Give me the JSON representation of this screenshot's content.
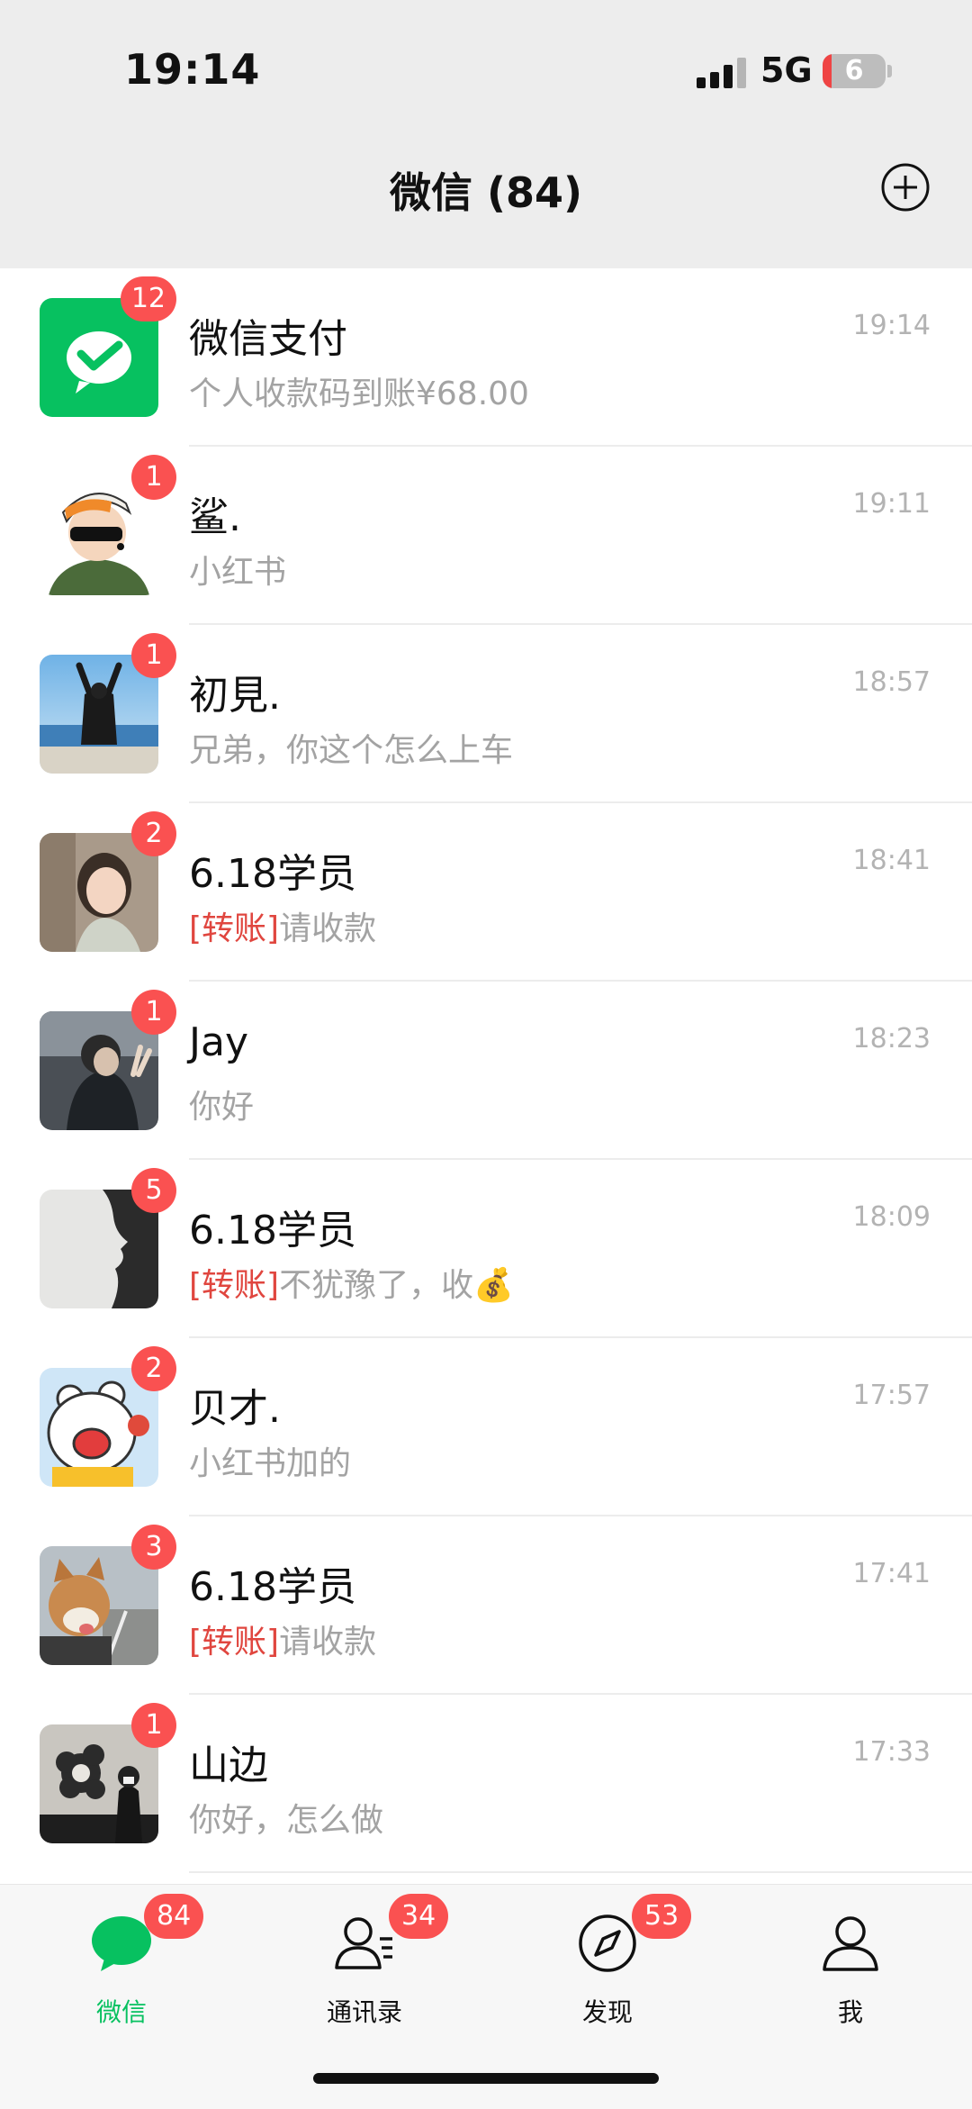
{
  "status": {
    "time": "19:14",
    "network": "5G",
    "battery": "6"
  },
  "header": {
    "title": "微信 (84)"
  },
  "chats": [
    {
      "name": "微信支付",
      "preview": "个人收款码到账¥68.00",
      "time": "19:14",
      "unread": "12",
      "avatar": "wechat-pay-icon"
    },
    {
      "name": "鲨.",
      "preview": "小红书",
      "time": "19:11",
      "unread": "1",
      "avatar": "cartoon-avatar"
    },
    {
      "name": "初見.",
      "preview": "兄弟，你这个怎么上车",
      "time": "18:57",
      "unread": "1",
      "avatar": "beach-photo"
    },
    {
      "name": "6.18学员",
      "tag": "[转账]",
      "preview": "请收款",
      "time": "18:41",
      "unread": "2",
      "avatar": "girl-photo"
    },
    {
      "name": "Jay",
      "preview": "你好",
      "time": "18:23",
      "unread": "1",
      "avatar": "car-photo"
    },
    {
      "name": "6.18学员",
      "tag": "[转账]",
      "preview": "不犹豫了，收💰",
      "time": "18:09",
      "unread": "5",
      "avatar": "silhouette-photo"
    },
    {
      "name": "贝才.",
      "preview": "小红书加的",
      "time": "17:57",
      "unread": "2",
      "avatar": "bear-cartoon"
    },
    {
      "name": "6.18学员",
      "tag": "[转账]",
      "preview": "请收款",
      "time": "17:41",
      "unread": "3",
      "avatar": "dog-photo"
    },
    {
      "name": "山边",
      "preview": "你好，怎么做",
      "time": "17:33",
      "unread": "1",
      "avatar": "flower-photo"
    }
  ],
  "tabs": [
    {
      "label": "微信",
      "badge": "84",
      "icon": "chat-bubble-icon",
      "active": true
    },
    {
      "label": "通讯录",
      "badge": "34",
      "icon": "contacts-icon"
    },
    {
      "label": "发现",
      "badge": "53",
      "icon": "compass-icon"
    },
    {
      "label": "我",
      "badge": "",
      "icon": "person-icon"
    }
  ],
  "colors": {
    "accent": "#07c160",
    "badge": "#fa5151",
    "transfer_tag": "#e0463f",
    "header_bg": "#ededed"
  }
}
